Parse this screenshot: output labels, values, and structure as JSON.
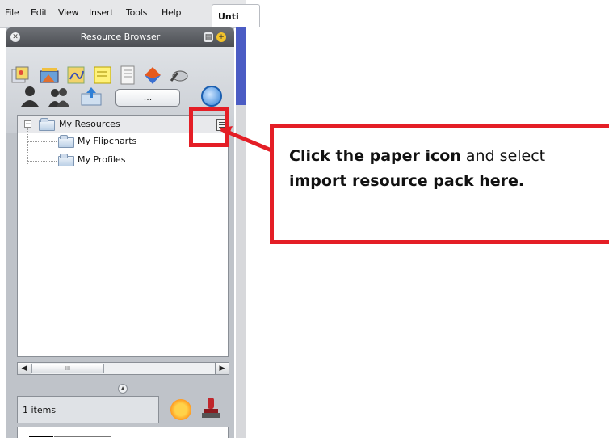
{
  "menu": {
    "items": [
      "File",
      "Edit",
      "View",
      "Insert",
      "Tools",
      "Help"
    ],
    "document_tab": "Unti"
  },
  "panel": {
    "title": "Resource Browser",
    "ellipsis_button": "...",
    "tree": {
      "root": "My Resources",
      "children": [
        "My Flipcharts",
        "My Profiles"
      ]
    },
    "items_count": "1 items"
  },
  "callout": {
    "part1_bold": "Click the paper icon",
    "part2": " and select ",
    "part3_bold": "import resource pack here",
    "part4": "."
  },
  "colors": {
    "annotation_red": "#e41e26",
    "title_bar": "#5a5d62",
    "panel_bg": "#bfc3c9"
  }
}
